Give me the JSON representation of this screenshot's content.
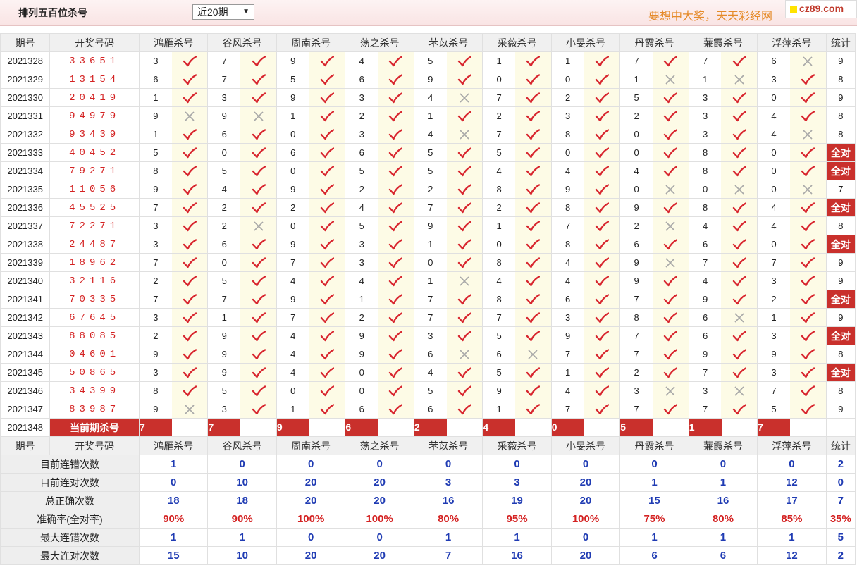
{
  "header": {
    "title": "排列五百位杀号",
    "range_selected": "近20期",
    "marquee": "要想中大奖，天天彩经网",
    "brand": "cz89.com"
  },
  "columns": {
    "period": "期号",
    "draw": "开奖号码",
    "experts": [
      "鸿雁杀号",
      "谷风杀号",
      "周南杀号",
      "荡之杀号",
      "芣苡杀号",
      "采薇杀号",
      "小旻杀号",
      "丹霞杀号",
      "蒹霞杀号",
      "浮萍杀号"
    ],
    "stat": "统计"
  },
  "rows": [
    {
      "period": "2021328",
      "draw": "33651",
      "kills": [
        3,
        7,
        9,
        4,
        5,
        1,
        1,
        7,
        7,
        6
      ],
      "ok": [
        1,
        1,
        1,
        1,
        1,
        1,
        1,
        1,
        1,
        0
      ],
      "stat": "9"
    },
    {
      "period": "2021329",
      "draw": "13154",
      "kills": [
        6,
        7,
        5,
        6,
        9,
        0,
        0,
        1,
        1,
        3
      ],
      "ok": [
        1,
        1,
        1,
        1,
        1,
        1,
        1,
        0,
        0,
        1
      ],
      "stat": "8"
    },
    {
      "period": "2021330",
      "draw": "20419",
      "kills": [
        1,
        3,
        9,
        3,
        4,
        7,
        2,
        5,
        3,
        0
      ],
      "ok": [
        1,
        1,
        1,
        1,
        0,
        1,
        1,
        1,
        1,
        1
      ],
      "stat": "9"
    },
    {
      "period": "2021331",
      "draw": "94979",
      "kills": [
        9,
        9,
        1,
        2,
        1,
        2,
        3,
        2,
        3,
        4
      ],
      "ok": [
        0,
        0,
        1,
        1,
        1,
        1,
        1,
        1,
        1,
        1
      ],
      "stat": "8"
    },
    {
      "period": "2021332",
      "draw": "93439",
      "kills": [
        1,
        6,
        0,
        3,
        4,
        7,
        8,
        0,
        3,
        4
      ],
      "ok": [
        1,
        1,
        1,
        1,
        0,
        1,
        1,
        1,
        1,
        0
      ],
      "stat": "8"
    },
    {
      "period": "2021333",
      "draw": "40452",
      "kills": [
        5,
        0,
        6,
        6,
        5,
        5,
        0,
        0,
        8,
        0
      ],
      "ok": [
        1,
        1,
        1,
        1,
        1,
        1,
        1,
        1,
        1,
        1
      ],
      "stat": "全对"
    },
    {
      "period": "2021334",
      "draw": "79271",
      "kills": [
        8,
        5,
        0,
        5,
        5,
        4,
        4,
        4,
        8,
        0
      ],
      "ok": [
        1,
        1,
        1,
        1,
        1,
        1,
        1,
        1,
        1,
        1
      ],
      "stat": "全对"
    },
    {
      "period": "2021335",
      "draw": "11056",
      "kills": [
        9,
        4,
        9,
        2,
        2,
        8,
        9,
        0,
        0,
        0
      ],
      "ok": [
        1,
        1,
        1,
        1,
        1,
        1,
        1,
        0,
        0,
        0
      ],
      "stat": "7"
    },
    {
      "period": "2021336",
      "draw": "45525",
      "kills": [
        7,
        2,
        2,
        4,
        7,
        2,
        8,
        9,
        8,
        4
      ],
      "ok": [
        1,
        1,
        1,
        1,
        1,
        1,
        1,
        1,
        1,
        1
      ],
      "stat": "全对"
    },
    {
      "period": "2021337",
      "draw": "72271",
      "kills": [
        3,
        2,
        0,
        5,
        9,
        1,
        7,
        2,
        4,
        4
      ],
      "ok": [
        1,
        0,
        1,
        1,
        1,
        1,
        1,
        0,
        1,
        1
      ],
      "stat": "8"
    },
    {
      "period": "2021338",
      "draw": "24487",
      "kills": [
        3,
        6,
        9,
        3,
        1,
        0,
        8,
        6,
        6,
        0
      ],
      "ok": [
        1,
        1,
        1,
        1,
        1,
        1,
        1,
        1,
        1,
        1
      ],
      "stat": "全对"
    },
    {
      "period": "2021339",
      "draw": "18962",
      "kills": [
        7,
        0,
        7,
        3,
        0,
        8,
        4,
        9,
        7,
        7
      ],
      "ok": [
        1,
        1,
        1,
        1,
        1,
        1,
        1,
        0,
        1,
        1
      ],
      "stat": "9"
    },
    {
      "period": "2021340",
      "draw": "32116",
      "kills": [
        2,
        5,
        4,
        4,
        1,
        4,
        4,
        9,
        4,
        3
      ],
      "ok": [
        1,
        1,
        1,
        1,
        0,
        1,
        1,
        1,
        1,
        1
      ],
      "stat": "9"
    },
    {
      "period": "2021341",
      "draw": "70335",
      "kills": [
        7,
        7,
        9,
        1,
        7,
        8,
        6,
        7,
        9,
        2
      ],
      "ok": [
        1,
        1,
        1,
        1,
        1,
        1,
        1,
        1,
        1,
        1
      ],
      "stat": "全对"
    },
    {
      "period": "2021342",
      "draw": "67645",
      "kills": [
        3,
        1,
        7,
        2,
        7,
        7,
        3,
        8,
        6,
        1
      ],
      "ok": [
        1,
        1,
        1,
        1,
        1,
        1,
        1,
        1,
        0,
        1
      ],
      "stat": "9"
    },
    {
      "period": "2021343",
      "draw": "88085",
      "kills": [
        2,
        9,
        4,
        9,
        3,
        5,
        9,
        7,
        6,
        3
      ],
      "ok": [
        1,
        1,
        1,
        1,
        1,
        1,
        1,
        1,
        1,
        1
      ],
      "stat": "全对"
    },
    {
      "period": "2021344",
      "draw": "04601",
      "kills": [
        9,
        9,
        4,
        9,
        6,
        6,
        7,
        7,
        9,
        9
      ],
      "ok": [
        1,
        1,
        1,
        1,
        0,
        0,
        1,
        1,
        1,
        1
      ],
      "stat": "8"
    },
    {
      "period": "2021345",
      "draw": "50865",
      "kills": [
        3,
        9,
        4,
        0,
        4,
        5,
        1,
        2,
        7,
        3
      ],
      "ok": [
        1,
        1,
        1,
        1,
        1,
        1,
        1,
        1,
        1,
        1
      ],
      "stat": "全对"
    },
    {
      "period": "2021346",
      "draw": "34399",
      "kills": [
        8,
        5,
        0,
        0,
        5,
        9,
        4,
        3,
        3,
        7
      ],
      "ok": [
        1,
        1,
        1,
        1,
        1,
        1,
        1,
        0,
        0,
        1
      ],
      "stat": "8"
    },
    {
      "period": "2021347",
      "draw": "83987",
      "kills": [
        9,
        3,
        1,
        6,
        6,
        1,
        7,
        7,
        7,
        5
      ],
      "ok": [
        0,
        1,
        1,
        1,
        1,
        1,
        1,
        1,
        1,
        1
      ],
      "stat": "9"
    }
  ],
  "current": {
    "period": "2021348",
    "label": "当前期杀号",
    "kills": [
      7,
      7,
      9,
      6,
      2,
      4,
      0,
      5,
      1,
      7
    ]
  },
  "summary": [
    {
      "label": "目前连错次数",
      "values": [
        "1",
        "0",
        "0",
        "0",
        "0",
        "0",
        "0",
        "0",
        "0",
        "0"
      ],
      "stat": "2",
      "red": false
    },
    {
      "label": "目前连对次数",
      "values": [
        "0",
        "10",
        "20",
        "20",
        "3",
        "3",
        "20",
        "1",
        "1",
        "12"
      ],
      "stat": "0",
      "red": false
    },
    {
      "label": "总正确次数",
      "values": [
        "18",
        "18",
        "20",
        "20",
        "16",
        "19",
        "20",
        "15",
        "16",
        "17"
      ],
      "stat": "7",
      "red": false
    },
    {
      "label": "准确率(全对率)",
      "values": [
        "90%",
        "90%",
        "100%",
        "100%",
        "80%",
        "95%",
        "100%",
        "75%",
        "80%",
        "85%"
      ],
      "stat": "35%",
      "red": true
    },
    {
      "label": "最大连错次数",
      "values": [
        "1",
        "1",
        "0",
        "0",
        "1",
        "1",
        "0",
        "1",
        "1",
        "1"
      ],
      "stat": "5",
      "red": false
    },
    {
      "label": "最大连对次数",
      "values": [
        "15",
        "10",
        "20",
        "20",
        "7",
        "16",
        "20",
        "6",
        "6",
        "12"
      ],
      "stat": "2",
      "red": false
    }
  ],
  "colors": {
    "accent": "#c9302c",
    "draw_red": "#d42222",
    "summary_blue": "#1f3bb3",
    "mark_bg": "#fdfbe6",
    "marquee": "#e58b2a"
  }
}
